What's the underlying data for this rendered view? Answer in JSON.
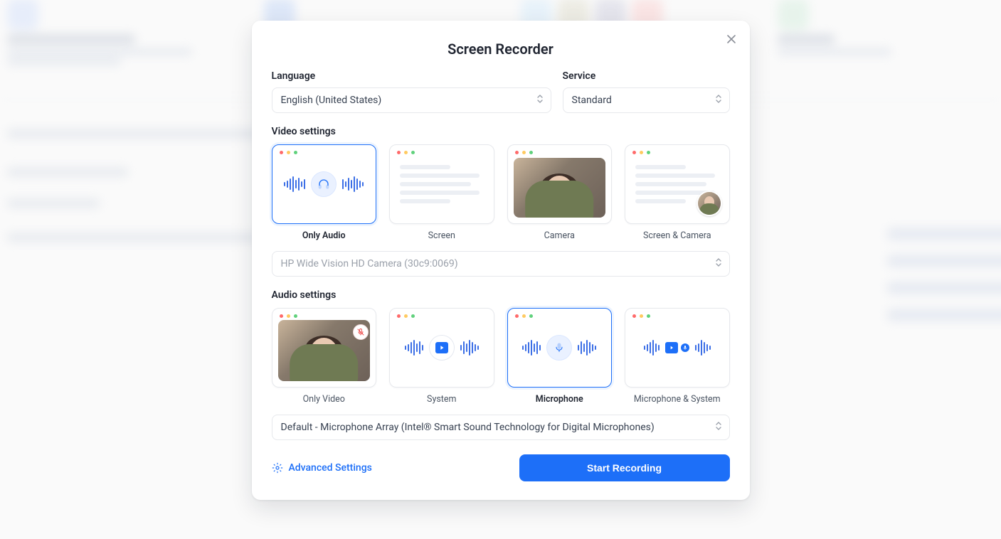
{
  "modal": {
    "title": "Screen Recorder",
    "language_label": "Language",
    "service_label": "Service",
    "language_value": "English (United States)",
    "service_value": "Standard",
    "video_label": "Video settings",
    "audio_label": "Audio settings",
    "camera_value": "HP Wide Vision HD Camera (30c9:0069)",
    "mic_value": "Default - Microphone Array (Intel® Smart Sound Technology for Digital Microphones)",
    "video_options": {
      "only_audio": "Only Audio",
      "screen": "Screen",
      "camera": "Camera",
      "screen_camera": "Screen & Camera"
    },
    "audio_options": {
      "only_video": "Only Video",
      "system": "System",
      "microphone": "Microphone",
      "mic_system": "Microphone & System"
    },
    "advanced": "Advanced Settings",
    "start": "Start Recording"
  }
}
